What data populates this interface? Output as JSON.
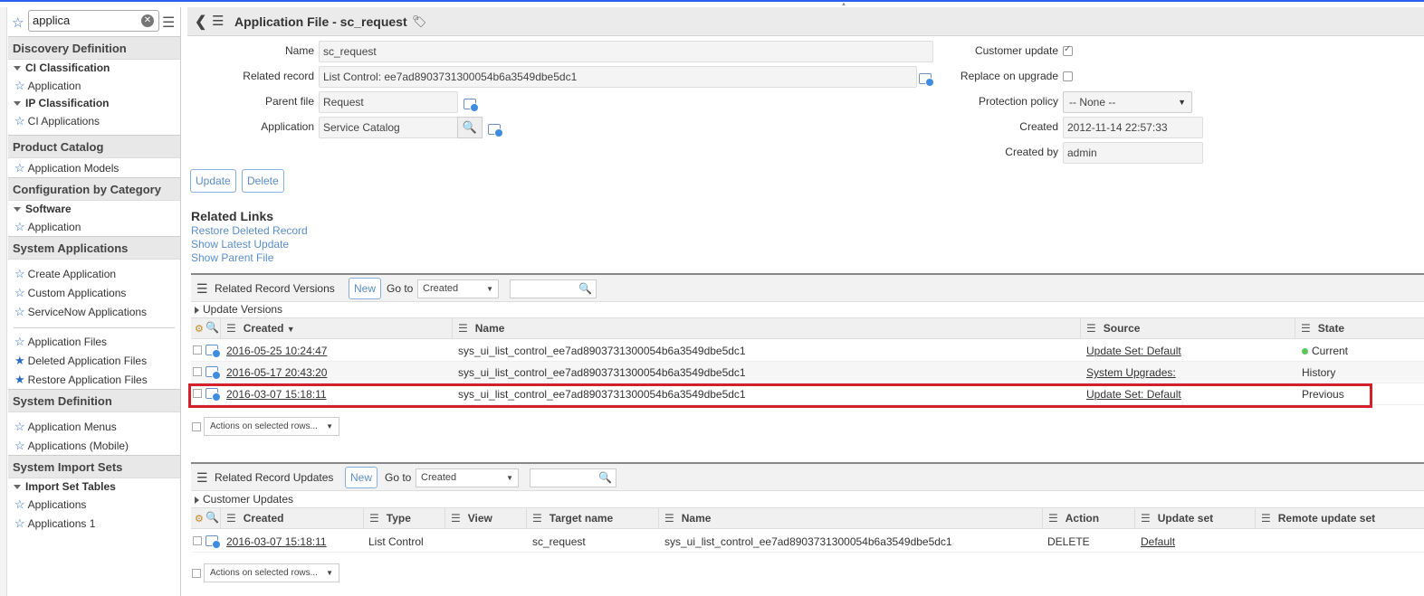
{
  "nav": {
    "filter_value": "applica",
    "sections": [
      {
        "title": "Discovery Definition"
      },
      {
        "title": "Product Catalog"
      },
      {
        "title": "Configuration by Category"
      },
      {
        "title": "System Applications"
      },
      {
        "title": "System Definition"
      },
      {
        "title": "System Import Sets"
      }
    ],
    "groups": {
      "ci_classification": "CI Classification",
      "ip_classification": "IP Classification",
      "software": "Software",
      "import_set_tables": "Import Set Tables"
    },
    "items": {
      "application_ci": "Application",
      "ci_applications": "CI Applications",
      "application_models": "Application Models",
      "application_sw": "Application",
      "create_application": "Create Application",
      "custom_applications": "Custom Applications",
      "servicenow_applications": "ServiceNow Applications",
      "application_files": "Application Files",
      "deleted_application_files": "Deleted Application Files",
      "restore_application_files": "Restore Application Files",
      "application_menus": "Application Menus",
      "applications_mobile": "Applications (Mobile)",
      "applications": "Applications",
      "applications_1": "Applications 1"
    }
  },
  "header": {
    "title": "Application File - sc_request"
  },
  "form": {
    "name_label": "Name",
    "name_value": "sc_request",
    "related_record_label": "Related record",
    "related_record_value": "List Control: ee7ad8903731300054b6a3549dbe5dc1",
    "parent_file_label": "Parent file",
    "parent_file_value": "Request",
    "application_label": "Application",
    "application_value": "Service Catalog",
    "customer_update_label": "Customer update",
    "replace_on_upgrade_label": "Replace on upgrade",
    "protection_policy_label": "Protection policy",
    "protection_policy_value": "-- None --",
    "created_label": "Created",
    "created_value": "2012-11-14 22:57:33",
    "created_by_label": "Created by",
    "created_by_value": "admin",
    "update_button": "Update",
    "delete_button": "Delete"
  },
  "related_links": {
    "title": "Related Links",
    "links": [
      "Restore Deleted Record",
      "Show Latest Update",
      "Show Parent File"
    ]
  },
  "versions": {
    "title": "Related Record Versions",
    "new_label": "New",
    "goto_label": "Go to",
    "goto_value": "Created",
    "subtitle": "Update Versions",
    "columns": [
      "Created",
      "Name",
      "Source",
      "State"
    ],
    "sort_indicator": "▼",
    "rows": [
      {
        "created": "2016-05-25 10:24:47",
        "name": "sys_ui_list_control_ee7ad8903731300054b6a3549dbe5dc1",
        "source": "Update Set: Default",
        "state": "Current"
      },
      {
        "created": "2016-05-17 20:43:20",
        "name": "sys_ui_list_control_ee7ad8903731300054b6a3549dbe5dc1",
        "source": "System Upgrades:",
        "state": "History"
      },
      {
        "created": "2016-03-07 15:18:11",
        "name": "sys_ui_list_control_ee7ad8903731300054b6a3549dbe5dc1",
        "source": "Update Set: Default",
        "state": "Previous"
      }
    ],
    "actions_label": "Actions on selected rows..."
  },
  "updates": {
    "title": "Related Record Updates",
    "new_label": "New",
    "goto_label": "Go to",
    "goto_value": "Created",
    "subtitle": "Customer Updates",
    "columns": [
      "Created",
      "Type",
      "View",
      "Target name",
      "Name",
      "Action",
      "Update set",
      "Remote update set"
    ],
    "rows": [
      {
        "created": "2016-03-07 15:18:11",
        "type": "List Control",
        "view": "",
        "target_name": "sc_request",
        "name": "sys_ui_list_control_ee7ad8903731300054b6a3549dbe5dc1",
        "action": "DELETE",
        "update_set": "Default",
        "remote_update_set": ""
      }
    ],
    "actions_label": "Actions on selected rows..."
  },
  "colors": {
    "accent": "#2c5ef0",
    "link": "#5a8ec9",
    "highlight": "#d4202a",
    "current_dot": "#5cc85c"
  }
}
